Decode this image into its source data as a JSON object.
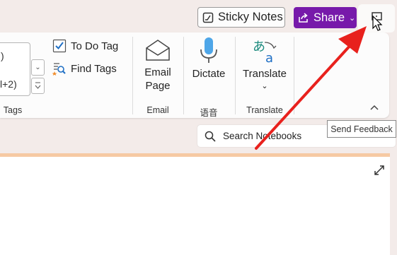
{
  "topbar": {
    "sticky_notes_label": "Sticky Notes",
    "share_label": "Share"
  },
  "ribbon": {
    "gallery_text_top": ")",
    "gallery_text_bottom": "l+2)",
    "tags": {
      "todo_tag_label": "To Do Tag",
      "find_tags_label": "Find Tags",
      "group_label": "Tags"
    },
    "email": {
      "button_line1": "Email",
      "button_line2": "Page",
      "group_label": "Email"
    },
    "voice": {
      "dictate_label": "Dictate",
      "group_label": "语音"
    },
    "translate": {
      "button_label": "Translate",
      "group_label": "Translate"
    }
  },
  "search": {
    "placeholder": "Search Notebooks"
  },
  "tooltip": {
    "text": "Send Feedback"
  },
  "colors": {
    "share_bg": "#7719aa",
    "page_strip": "#f6c9a3",
    "arrow": "#e8211d",
    "app_bg": "#f3ebe9"
  },
  "icons": [
    "sticky-notes-icon",
    "share-icon",
    "chevron-down-icon",
    "feedback-icon",
    "mouse-cursor-icon",
    "checkbox-icon",
    "find-tags-icon",
    "email-icon",
    "microphone-icon",
    "translate-icon",
    "collapse-ribbon-icon",
    "search-icon",
    "expand-icon"
  ]
}
